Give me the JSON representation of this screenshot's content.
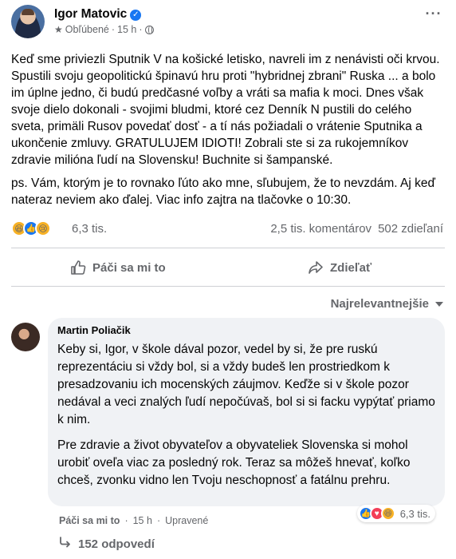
{
  "post": {
    "author": "Igor Matovic",
    "meta_favorite": "Obľúbené",
    "meta_time": "15 h",
    "meta_sep": "·",
    "paragraph_1": "Keď sme priviezli Sputnik V na košické letisko, navreli im z nenávisti oči krvou. Spustili svoju geopolitickú špinavú hru proti \"hybridnej zbrani\" Ruska ... a bolo im úplne jedno, či budú predčasné voľby a vráti sa mafia k moci. Dnes však svoje dielo dokonali - svojimi bludmi, ktoré cez Denník N pustili do celého sveta, primäli Rusov povedať dosť - a tí nás požiadali o vrátenie Sputnika a ukončenie zmluvy. GRATULUJEM IDIOTI! Zobrali ste si za rukojemníkov zdravie milióna ľudí na Slovensku! Buchnite si šampanské.",
    "paragraph_2": "ps. Vám, ktorým je to rovnako ľúto ako mne, sľubujem, že to nevzdám. Aj keď nateraz neviem ako ďalej. Viac info zajtra na tlačovke o 10:30.",
    "reactions_count": "6,3 tis.",
    "comments_count": "2,5 tis. komentárov",
    "shares_count": "502 zdieľaní",
    "like_label": "Páči sa mi to",
    "share_label": "Zdieľať",
    "sort_label": "Najrelevantnejšie"
  },
  "comment": {
    "author": "Martin Poliačik",
    "paragraph_1": "Keby si, Igor, v škole dával pozor, vedel by si, že pre ruskú reprezentáciu si vždy bol, si a vždy budeš len prostriedkom k presadzovaniu ich mocenských záujmov. Keďže si v škole pozor nedával a veci znalých ľudí nepočúvaš, bol si si facku vypýtať priamo k nim.",
    "paragraph_2": "Pre zdravie a život obyvateľov a obyvateliek Slovenska si mohol urobiť oveľa viac za posledný rok. Teraz sa môžeš hnevať, koľko chceš, zvonku vidno len Tvoju neschopnosť a fatálnu prehru.",
    "reactions_count": "6,3 tis.",
    "like_label": "Páči sa mi to",
    "time": "15 h",
    "edited": "Upravené",
    "sep": "·",
    "replies_label": "152 odpovedí"
  },
  "icons": {
    "verified": "verified-badge-icon",
    "favorite": "star-icon",
    "audience": "globe-icon",
    "more": "more-options-icon",
    "like": "thumbs-up-icon",
    "share": "share-arrow-icon",
    "sort": "chevron-down-icon",
    "replies": "reply-arrow-icon"
  },
  "colors": {
    "accent": "#1877f2",
    "secondary_text": "#65676b",
    "comment_bg": "#f0f2f5"
  }
}
